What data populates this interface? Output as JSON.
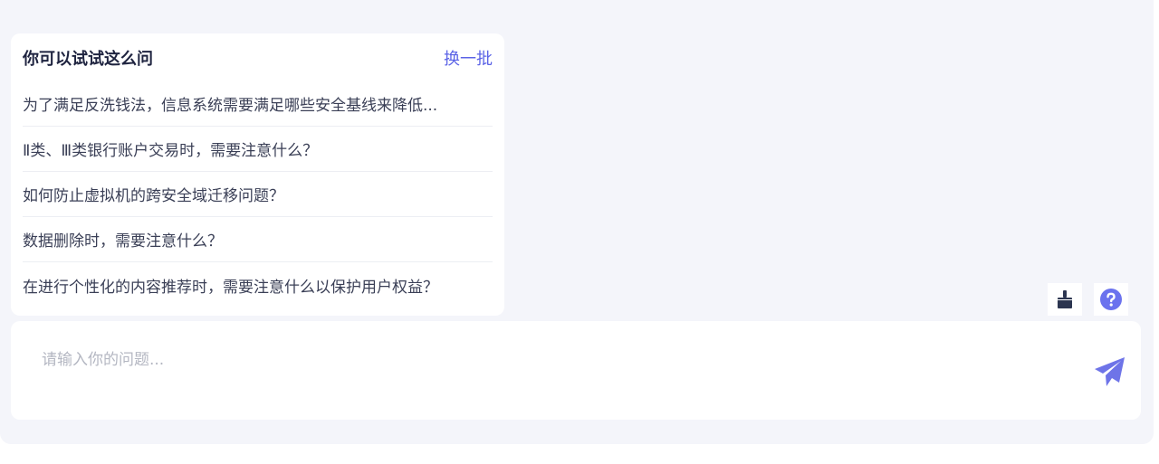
{
  "suggestions": {
    "title": "你可以试试这么问",
    "refresh_label": "换一批",
    "items": [
      "为了满足反洗钱法，信息系统需要满足哪些安全基线来降低...",
      "Ⅱ类、Ⅲ类银行账户交易时，需要注意什么？",
      "如何防止虚拟机的跨安全域迁移问题？",
      "数据删除时，需要注意什么？",
      "在进行个性化的内容推荐时，需要注意什么以保护用户权益？"
    ]
  },
  "toolbar": {
    "clear_icon": "broom-icon",
    "help_icon": "help-icon"
  },
  "composer": {
    "value": "",
    "placeholder": "请输入你的问题...",
    "send_icon": "send-icon"
  },
  "colors": {
    "accent": "#5b63e6",
    "panel_bg": "#f4f5fa",
    "dark_icon": "#2c3550",
    "help_icon": "#6b72ee",
    "send_icon": "#6e74e8"
  }
}
